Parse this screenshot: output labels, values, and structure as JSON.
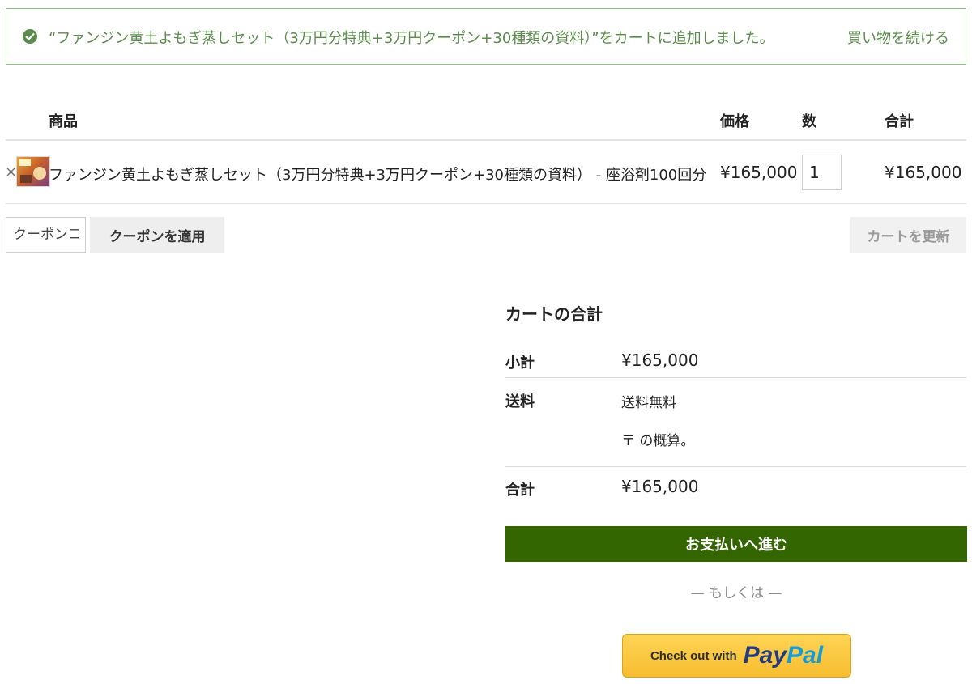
{
  "notice": {
    "message": "“ファンジン黄土よもぎ蒸しセット（3万円分特典+3万円クーポン+30種類の資料）”をカートに追加しました。",
    "continue_label": "買い物を続ける",
    "color": "#5b8b4c"
  },
  "table": {
    "headers": {
      "product": "商品",
      "price": "価格",
      "quantity": "数",
      "subtotal": "合計"
    },
    "items": [
      {
        "remove": "×",
        "name": "ファンジン黄土よもぎ蒸しセット（3万円分特典+3万円クーポン+30種類の資料） - 座浴剤100回分",
        "price": "¥165,000",
        "quantity": "1",
        "subtotal": "¥165,000"
      }
    ]
  },
  "coupon": {
    "placeholder": "クーポンコード",
    "apply_label": "クーポンを適用",
    "update_label": "カートを更新"
  },
  "totals": {
    "title": "カートの合計",
    "subtotal_label": "小計",
    "subtotal_value": "¥165,000",
    "shipping_label": "送料",
    "shipping_value": "送料無料",
    "shipping_note": "〒 の概算。",
    "total_label": "合計",
    "total_value": "¥165,000"
  },
  "checkout": {
    "button_label": "お支払いへ進む",
    "button_color": "#336600",
    "or_label": "— もしくは —",
    "paypal_prefix": "Check out with",
    "paypal_pay": "Pay",
    "paypal_pal": "Pal"
  }
}
